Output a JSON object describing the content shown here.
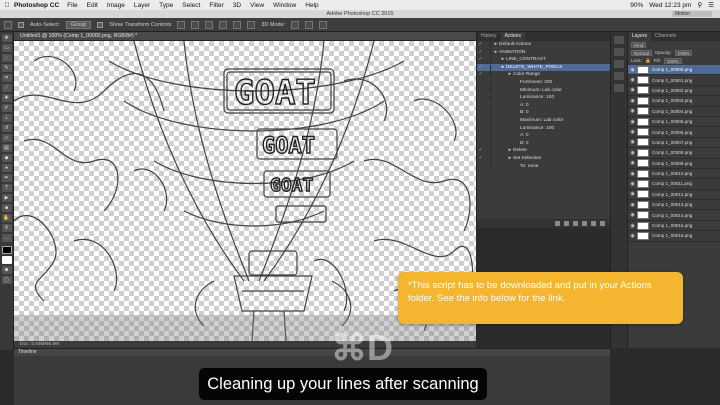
{
  "menubar": {
    "app": "Photoshop CC",
    "items": [
      "File",
      "Edit",
      "Image",
      "Layer",
      "Type",
      "Select",
      "Filter",
      "3D",
      "View",
      "Window",
      "Help"
    ],
    "battery": "90%",
    "clock": "Wed 12:23 pm"
  },
  "titlebar": {
    "title": "Adobe Photoshop CC 2015",
    "workspace": "Motion"
  },
  "options": {
    "auto_select_label": "Auto-Select:",
    "auto_select_value": "Group",
    "transform_label": "Show Transform Controls",
    "mode_label": "3D Mode:"
  },
  "document": {
    "tab": "Untitled1 @ 100% (Comp 1_00000.png, RGB/8#) *",
    "status": "Doc: 5.93M/95.9M"
  },
  "timeline": {
    "label": "Timeline"
  },
  "actions_panel": {
    "tabs": [
      "History",
      "Actions"
    ],
    "rows": [
      {
        "text": "Default Actions",
        "indent": 0,
        "check": "✓",
        "selected": false
      },
      {
        "text": "ANIMATION",
        "indent": 0,
        "check": "✓",
        "selected": false
      },
      {
        "text": "LINE_CONTRAST",
        "indent": 1,
        "check": "✓",
        "selected": false
      },
      {
        "text": "DELETE_WHITE_PIXELS",
        "indent": 1,
        "check": "✓",
        "selected": true
      },
      {
        "text": "Color Range",
        "indent": 2,
        "check": "✓",
        "selected": false
      },
      {
        "text": "Fuzziness: 200",
        "indent": 3,
        "check": "",
        "selected": false
      },
      {
        "text": "Minimum: Lab color",
        "indent": 3,
        "check": "",
        "selected": false
      },
      {
        "text": "Luminance: 100",
        "indent": 3,
        "check": "",
        "selected": false
      },
      {
        "text": "A: 0",
        "indent": 3,
        "check": "",
        "selected": false
      },
      {
        "text": "B: 0",
        "indent": 3,
        "check": "",
        "selected": false
      },
      {
        "text": "Maximum: Lab color",
        "indent": 3,
        "check": "",
        "selected": false
      },
      {
        "text": "Luminance: 100",
        "indent": 3,
        "check": "",
        "selected": false
      },
      {
        "text": "A: 0",
        "indent": 3,
        "check": "",
        "selected": false
      },
      {
        "text": "B: 0",
        "indent": 3,
        "check": "",
        "selected": false
      },
      {
        "text": "Delete",
        "indent": 2,
        "check": "✓",
        "selected": false
      },
      {
        "text": "Set Selection",
        "indent": 2,
        "check": "✓",
        "selected": false
      },
      {
        "text": "To: none",
        "indent": 3,
        "check": "",
        "selected": false
      }
    ]
  },
  "layers_panel": {
    "tabs": [
      "Layers",
      "Channels"
    ],
    "kind": "Kind",
    "blend": "Normal",
    "opacity_label": "Opacity:",
    "opacity_value": "100%",
    "lock_label": "Lock:",
    "fill_label": "Fill:",
    "fill_value": "100%",
    "layers": [
      {
        "name": "Comp 1_00000.png",
        "selected": true
      },
      {
        "name": "Comp 1_00001.png",
        "selected": false
      },
      {
        "name": "Comp 1_00002.png",
        "selected": false
      },
      {
        "name": "Comp 1_00003.png",
        "selected": false
      },
      {
        "name": "Comp 1_00004.png",
        "selected": false
      },
      {
        "name": "Comp 1_00005.png",
        "selected": false
      },
      {
        "name": "Comp 1_00006.png",
        "selected": false
      },
      {
        "name": "Comp 1_00007.png",
        "selected": false
      },
      {
        "name": "Comp 1_00008.png",
        "selected": false
      },
      {
        "name": "Comp 1_00009.png",
        "selected": false
      },
      {
        "name": "Comp 1_00010.png",
        "selected": false
      },
      {
        "name": "Comp 1_00011.png",
        "selected": false
      },
      {
        "name": "Comp 1_00012.png",
        "selected": false
      },
      {
        "name": "Comp 1_00013.png",
        "selected": false
      },
      {
        "name": "Comp 1_00014.png",
        "selected": false
      },
      {
        "name": "Comp 1_00015.png",
        "selected": false
      },
      {
        "name": "Comp 1_00016.png",
        "selected": false
      }
    ]
  },
  "canvas_art": {
    "sign_text": "GOAT"
  },
  "note": {
    "text": "*This script has to be downloaded and put in your Actions folder.  See the info below for the link."
  },
  "caption": {
    "text": "Cleaning up your lines after scanning"
  },
  "watermark": {
    "text": "⌘D"
  },
  "colors": {
    "note_bg": "#f4b531",
    "selection": "#4f6b95"
  }
}
